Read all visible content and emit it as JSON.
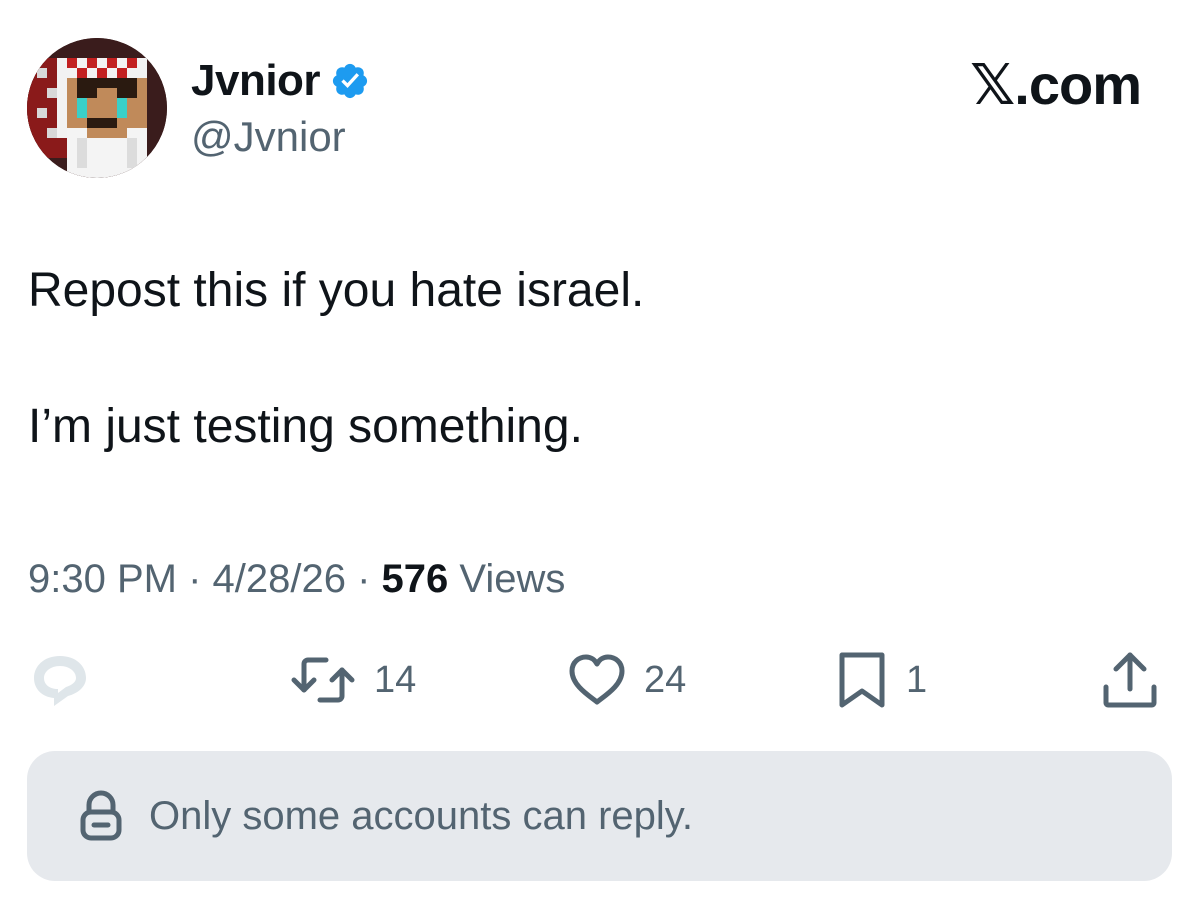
{
  "author": {
    "display_name": "Jvnior",
    "handle": "@Jvnior",
    "verified_icon": "verified-badge-icon",
    "avatar": "pixel-art-avatar"
  },
  "brand": {
    "label": "𝕏.com"
  },
  "tweet": {
    "line1": "Repost this if you hate israel.",
    "line2": "I’m just testing something."
  },
  "meta": {
    "time": "9:30 PM",
    "separator": " · ",
    "date": "4/28/26",
    "views_count": "576",
    "views_label": "Views"
  },
  "actions": {
    "reply": {
      "icon": "reply-icon",
      "count": ""
    },
    "repost": {
      "icon": "repost-icon",
      "count": "14"
    },
    "like": {
      "icon": "heart-icon",
      "count": "24"
    },
    "bookmark": {
      "icon": "bookmark-icon",
      "count": "1"
    },
    "share": {
      "icon": "share-icon"
    }
  },
  "reply_restriction": {
    "icon": "lock-icon",
    "text": "Only some accounts can reply."
  },
  "colors": {
    "text": "#0f1419",
    "secondary": "#536471",
    "verified_blue": "#1d9bf0",
    "reply_bar_bg": "#e6e9ed"
  }
}
